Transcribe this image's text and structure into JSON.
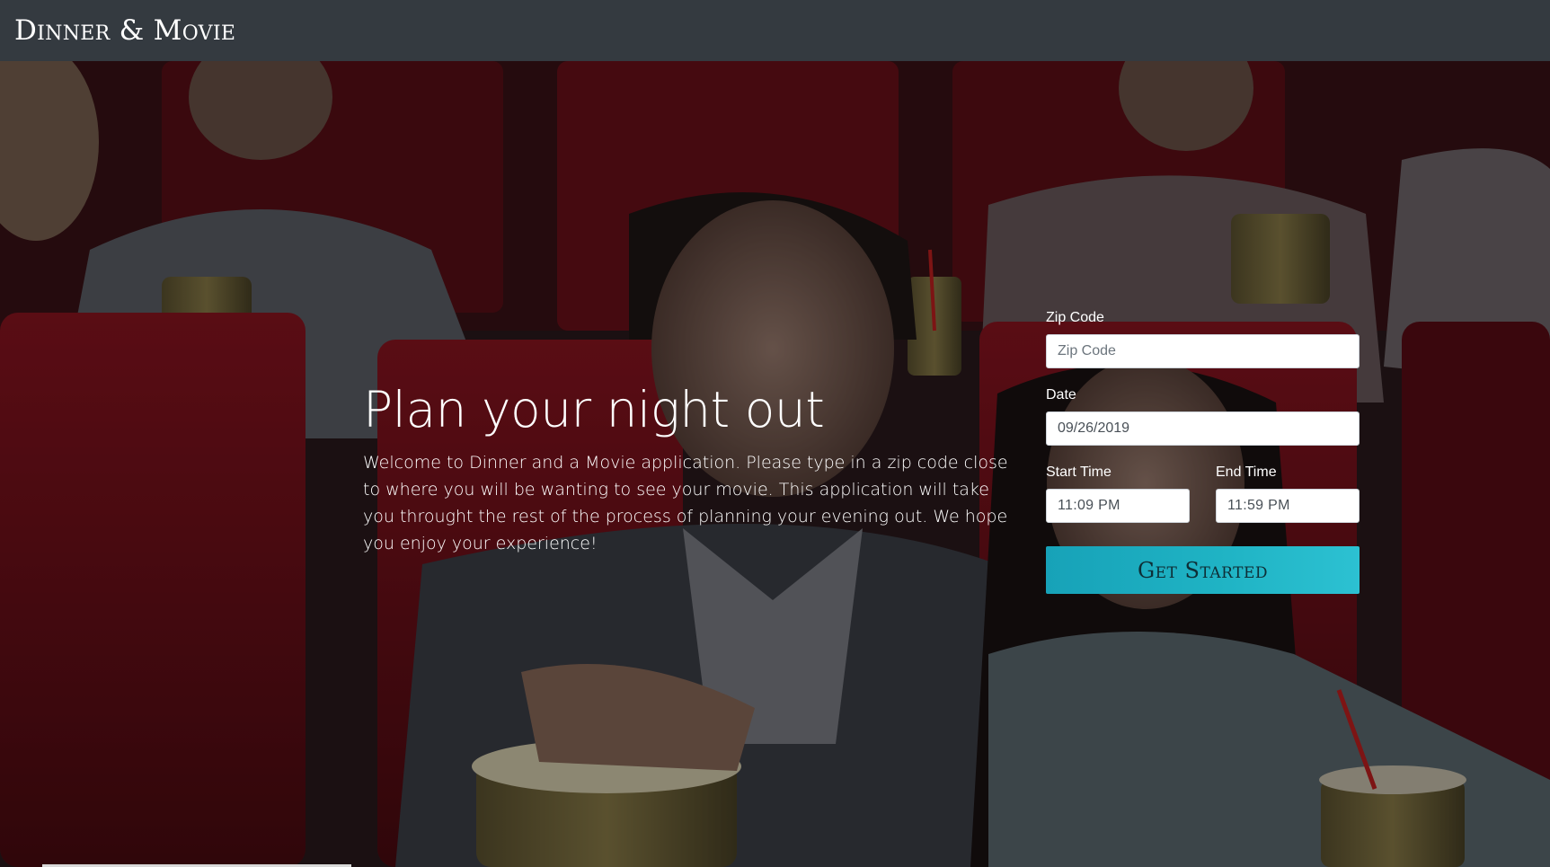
{
  "navbar": {
    "brand": "Dinner & Movie"
  },
  "hero": {
    "background": "movie theater audience photo",
    "title": "Plan your night out",
    "description": "Welcome to Dinner and a Movie application. Please type in a zip code close to where you will be wanting to see your movie. This application will take you throught the rest of the process of planning your evening out. We hope you enjoy your experience!"
  },
  "form": {
    "zip": {
      "label": "Zip Code",
      "placeholder": "Zip Code",
      "value": ""
    },
    "date": {
      "label": "Date",
      "value": "09/26/2019"
    },
    "start_time": {
      "label": "Start Time",
      "value": "11:09 PM"
    },
    "end_time": {
      "label": "End Time",
      "value": "11:59 PM"
    },
    "submit_label": "Get Started"
  },
  "colors": {
    "navbar": "#343a40",
    "button": "#17a2b8",
    "seat_red": "#7a0f18"
  }
}
